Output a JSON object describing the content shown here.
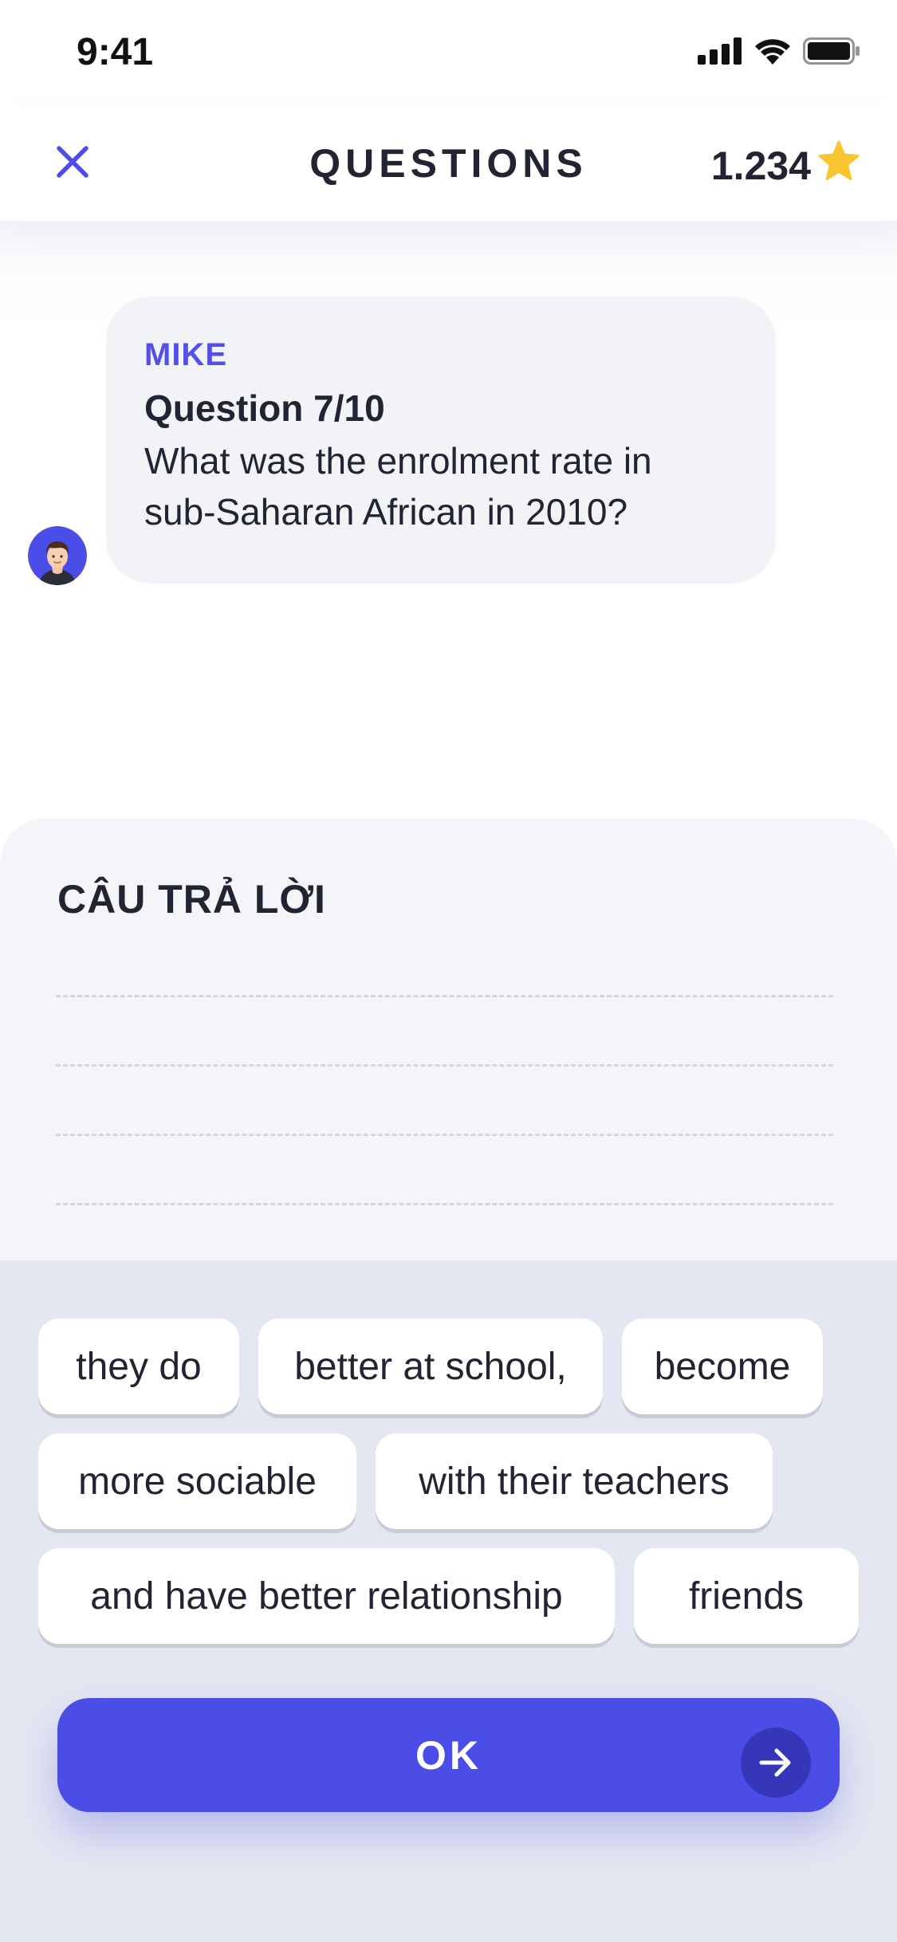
{
  "status_bar": {
    "time": "9:41",
    "icons": [
      "cellular-signal-icon",
      "wifi-icon",
      "battery-icon"
    ]
  },
  "header": {
    "close_icon": "close-icon",
    "title": "QUESTIONS",
    "score": "1.234",
    "score_icon": "star-icon"
  },
  "chat": {
    "avatar_icon": "avatar-icon",
    "sender": "MIKE",
    "question_label": "Question 7/10",
    "question_text_line1": "What was the enrolment rate in",
    "question_text_line2": "sub-Saharan African in 2010?"
  },
  "answer": {
    "title": "CÂU TRẢ LỜI",
    "blank_lines": 4
  },
  "word_bank": [
    "they do",
    "better at school,",
    "become",
    "more sociable",
    "with their teachers",
    "and have better relationship",
    "friends"
  ],
  "ok_button": {
    "label": "OK",
    "icon": "arrow-right-icon"
  },
  "colors": {
    "accent": "#4a4de6",
    "accent_dark": "#3537b8",
    "sender_name": "#5450e6",
    "text": "#222433",
    "star": "#f7c52d",
    "panel": "#f4f5f9",
    "tray": "#e4e7f1"
  }
}
